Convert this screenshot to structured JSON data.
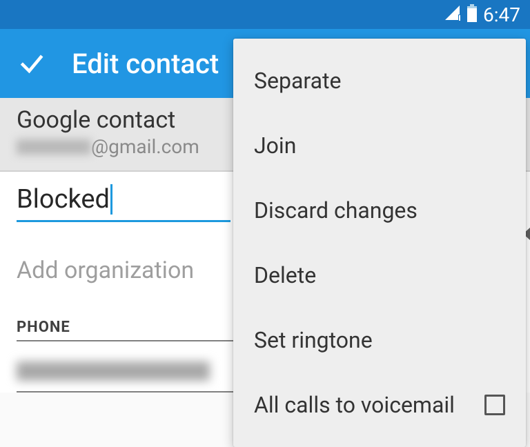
{
  "status": {
    "time": "6:47"
  },
  "appbar": {
    "title": "Edit contact"
  },
  "account": {
    "type": "Google contact",
    "email_suffix": "@gmail.com"
  },
  "fields": {
    "name_value": "Blocked",
    "org_placeholder": "Add organization",
    "phone_label": "PHONE"
  },
  "menu": {
    "separate": "Separate",
    "join": "Join",
    "discard": "Discard changes",
    "delete": "Delete",
    "ringtone": "Set ringtone",
    "voicemail": "All calls to voicemail"
  }
}
